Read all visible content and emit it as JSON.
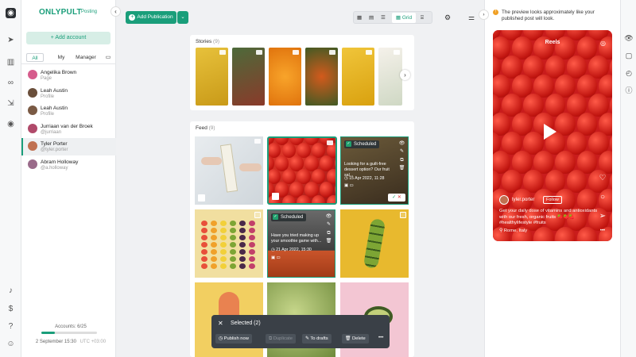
{
  "app": {
    "brand": "ONLYPULT",
    "brand_sub": "Posting"
  },
  "rail": {
    "icons": [
      "logo-icon",
      "send-icon",
      "chart-icon",
      "link-icon",
      "import-icon",
      "broadcast-icon",
      "bell-icon",
      "dollar-icon",
      "help-icon",
      "user-icon"
    ]
  },
  "accounts_panel": {
    "add_label": "+ Add account",
    "filter_tabs": [
      "All",
      "My",
      "Manager"
    ],
    "active_tab": "All",
    "accounts": [
      {
        "name": "Angelika Brown",
        "type": "Page",
        "color": "#d65c8c",
        "selected": false
      },
      {
        "name": "Leah Austin",
        "type": "Profile",
        "color": "#6a4f3b",
        "selected": false
      },
      {
        "name": "Leah Austin",
        "type": "Profile",
        "color": "#7a5a44",
        "selected": false
      },
      {
        "name": "Jurriaan van der Broek",
        "type": "@jurriaan",
        "color": "#b04a6a",
        "selected": false
      },
      {
        "name": "Tyler Porter",
        "type": "@tyler.porter",
        "color": "#c07050",
        "selected": true
      },
      {
        "name": "Abram Holloway",
        "type": "@a.holloway",
        "color": "#9a6b8a",
        "selected": false
      }
    ],
    "accounts_count": "Accounts: 6/25",
    "accounts_fill": 0.24,
    "datetime": "2 September 15:30",
    "timezone": "UTC +03:00"
  },
  "toolbar": {
    "add_publication": "Add Publication",
    "grid_label": "Grid"
  },
  "stories": {
    "title": "Stories",
    "count": "(9)"
  },
  "feed": {
    "title": "Feed",
    "count": "(9)",
    "scheduled_label": "Scheduled",
    "post1": {
      "text": "Looking for a guilt-free dessert option? Our fruit sal...",
      "date": "15 Apr 2022, 11:28"
    },
    "post2": {
      "text": "Have you tried making up your smoothie game with...",
      "date": "21 Apr 2022, 15:30"
    }
  },
  "selection_bar": {
    "title": "Selected (2)",
    "actions": [
      "Publish now",
      "Duplicate",
      "To drafts",
      "Delete"
    ],
    "more": "•••"
  },
  "preview": {
    "notice": "The preview looks approximately like your published post will look.",
    "label": "Reels",
    "username": "tyler.porter",
    "follow": "Follow",
    "caption": "Get your daily dose of vitamins and antioxidants with our fresh, organic fruits 🍓🍓🍓 #healthylifestyle #fruits",
    "location": "Rome, Italy"
  },
  "colors": {
    "accent": "#1a9e7a",
    "scheduled": "#21a06e"
  }
}
